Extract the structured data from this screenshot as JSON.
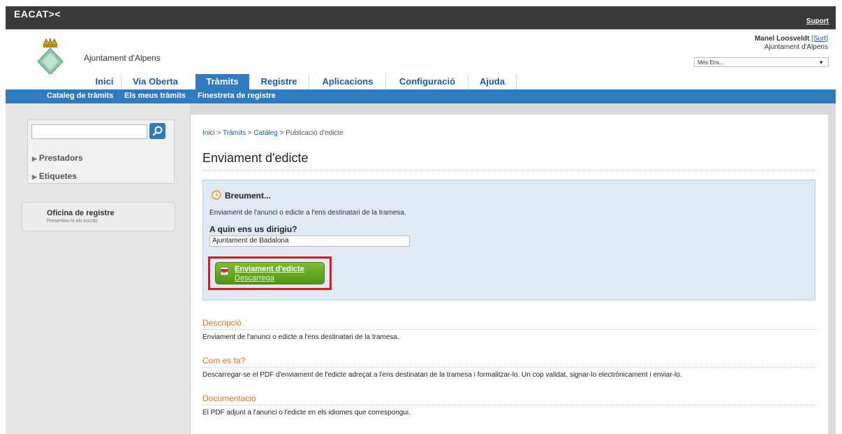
{
  "brand": {
    "logo": "EACAT><",
    "support": "Suport"
  },
  "header": {
    "org_name": "Ajuntament d'Alpens",
    "user_name": "Manel Loosveldt",
    "logout": "[Surt]",
    "user_org": "Ajuntament d'Alpens",
    "ens_select": "Més Ens..."
  },
  "tabs": [
    {
      "label": "Inici"
    },
    {
      "label": "Via Oberta"
    },
    {
      "label": "Tràmits",
      "active": true
    },
    {
      "label": "Registre"
    },
    {
      "label": "Aplicacions"
    },
    {
      "label": "Configuració"
    },
    {
      "label": "Ajuda"
    }
  ],
  "subnav": [
    "Cataleg de tràmits",
    "Els meus tràmits",
    "Finestreta de registre"
  ],
  "sidebar": {
    "search_placeholder": "",
    "links": [
      "Prestadors",
      "Etiquetes"
    ],
    "oficina_title": "Oficina de registre",
    "oficina_sub": "Presenteu-hi els escrits"
  },
  "breadcrumb": {
    "items": [
      "Inici",
      "Tràmits",
      "Catàleg"
    ],
    "sep": " > ",
    "current": "Publicació d'edicte"
  },
  "page_title": "Enviament d'edicte",
  "brief": {
    "title": "Breument...",
    "description": "Enviament de l'anunci o edicte a l'ens destinatari de la tramesa.",
    "question": "A quin ens us dirigiu?",
    "destination": "Ajuntament de Badalona",
    "download_label": "Enviament d'edicte",
    "download_sub": "Descarrega"
  },
  "sections": [
    {
      "heading": "Descripció",
      "text": "Enviament de l'anunci o edicte a l'ens destinatari de la tramesa."
    },
    {
      "heading": "Com es fa?",
      "text": "Descarregar-se el PDF d'enviament de l'edicte adreçat a l'ens destinatari de la tramesa i formalitzar-lo. Un cop validat, signar-lo electrònicament i enviar-lo."
    },
    {
      "heading": "Documentació",
      "text": "El PDF adjunt a l'anunci o l'edicte en els idiomes que correspongui."
    }
  ],
  "colors": {
    "nav_blue": "#2f7bc0",
    "link_blue": "#1a5aa6",
    "section_orange": "#e0731f",
    "button_green": "#5ea51f",
    "highlight_red": "#e01818"
  }
}
